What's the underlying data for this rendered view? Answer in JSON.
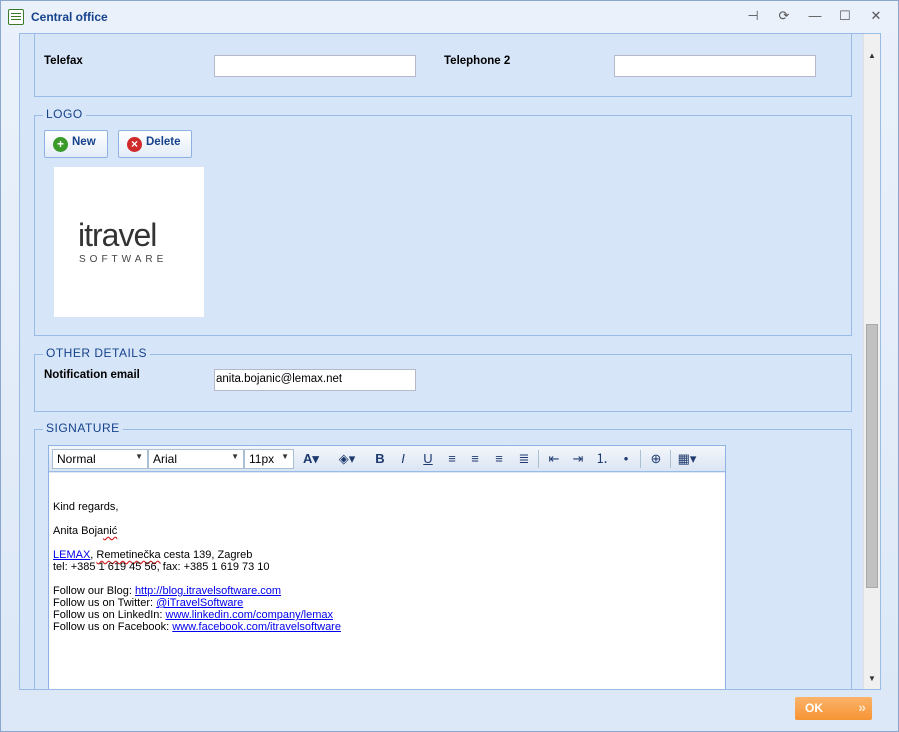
{
  "window": {
    "title": "Central office"
  },
  "titlebar_buttons": {
    "pin": "⊣",
    "refresh": "⟳",
    "minimize": "—",
    "maximize": "☐",
    "close": "✕"
  },
  "contact": {
    "telefax_label": "Telefax",
    "telefax_value": "",
    "telephone2_label": "Telephone 2",
    "telephone2_value": ""
  },
  "logo": {
    "legend": "LOGO",
    "new_label": "New",
    "delete_label": "Delete",
    "image_text": "itravel",
    "image_subtext": "SOFTWARE"
  },
  "other_details": {
    "legend": "OTHER DETAILS",
    "notification_email_label": "Notification email",
    "notification_email_value": "anita.bojanic@lemax.net"
  },
  "signature": {
    "legend": "SIGNATURE",
    "toolbar": {
      "format": "Normal",
      "font": "Arial",
      "size": "11px"
    },
    "lines": {
      "regards": "Kind regards,",
      "name_pre": "Anita Boja",
      "name_squig": "nić",
      "company_link": "LEMAX",
      "address_pre": ", ",
      "address_squig": "Remetinečka",
      "address_rest": " cesta 139, Zagreb",
      "phone": "tel: +385 1 619 45 56, fax: +385 1 619 73 10",
      "blog_label": "Follow our Blog: ",
      "blog_link": "http://blog.itravelsoftware.com",
      "twitter_label": "Follow us on Twitter: ",
      "twitter_link": "@iTravelSoftware",
      "linkedin_label": "Follow us on LinkedIn: ",
      "linkedin_link": "www.linkedin.com/company/lemax",
      "facebook_label": "Follow us on Facebook: ",
      "facebook_link": "www.facebook.com/itravelsoftware"
    }
  },
  "footer": {
    "ok_label": "OK"
  },
  "colors": {
    "accent": "#15428b",
    "panel": "#d7e5f8",
    "ok_button": "#f69434"
  }
}
